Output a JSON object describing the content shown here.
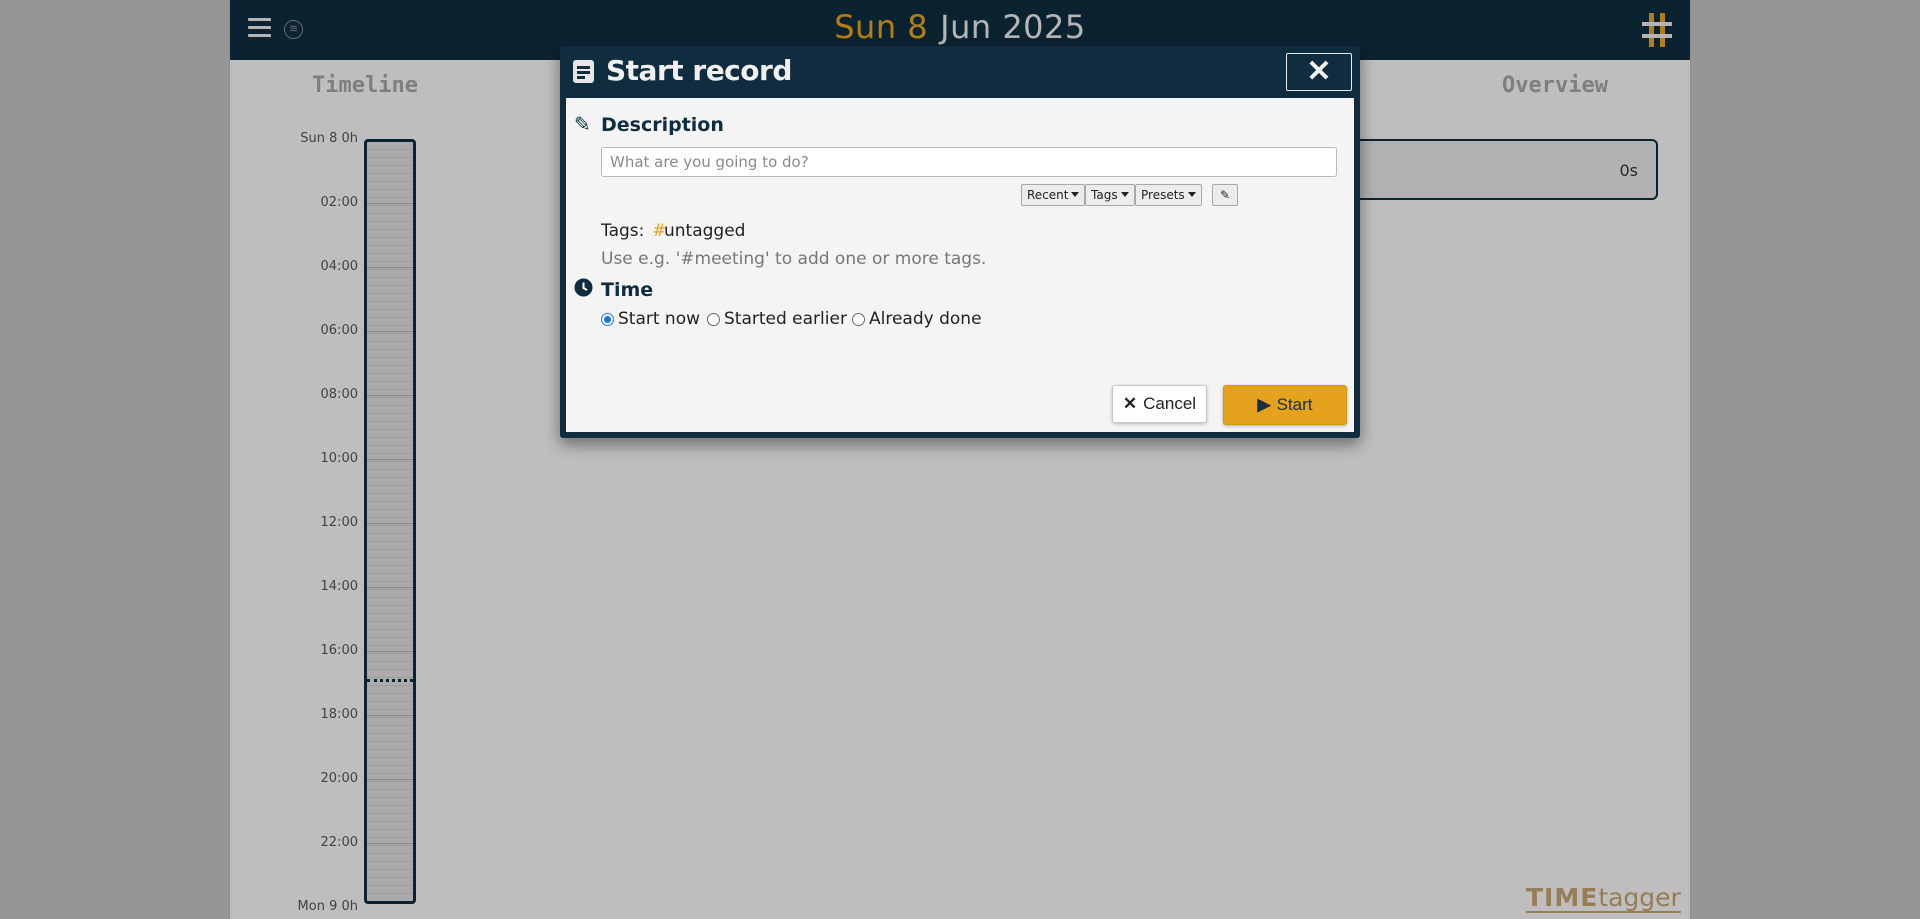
{
  "header": {
    "date_day": "Sun 8",
    "date_rest": "Jun 2025",
    "menu_icon": "hamburger-menu-icon",
    "sync_icon": "wifi-sync-icon",
    "logo_icon": "timetagger-logo-icon"
  },
  "timeline": {
    "heading": "Timeline",
    "ticks": [
      "Sun 8  0h",
      "02:00",
      "04:00",
      "06:00",
      "08:00",
      "10:00",
      "12:00",
      "14:00",
      "16:00",
      "18:00",
      "20:00",
      "22:00",
      "Mon 9  0h"
    ]
  },
  "overview": {
    "heading": "Overview",
    "total": "0s"
  },
  "brand": {
    "part1": "TIME",
    "part2": "tagger"
  },
  "dialog": {
    "title": "Start record",
    "close_label": "✕",
    "description_label": "Description",
    "description_placeholder": "What are you going to do?",
    "recent_label": "Recent",
    "tags_btn_label": "Tags",
    "presets_label": "Presets",
    "tags_prefix": "Tags:",
    "tag_hash": "#",
    "tag_name": "untagged",
    "tags_hint": "Use e.g. '#meeting' to add one or more tags.",
    "time_label": "Time",
    "time_options": [
      {
        "label": "Start now",
        "checked": true
      },
      {
        "label": "Started earlier",
        "checked": false
      },
      {
        "label": "Already done",
        "checked": false
      }
    ],
    "cancel_label": "Cancel",
    "start_label": "Start"
  },
  "colors": {
    "primary": "#0f2d3f",
    "accent": "#e5a21d"
  }
}
